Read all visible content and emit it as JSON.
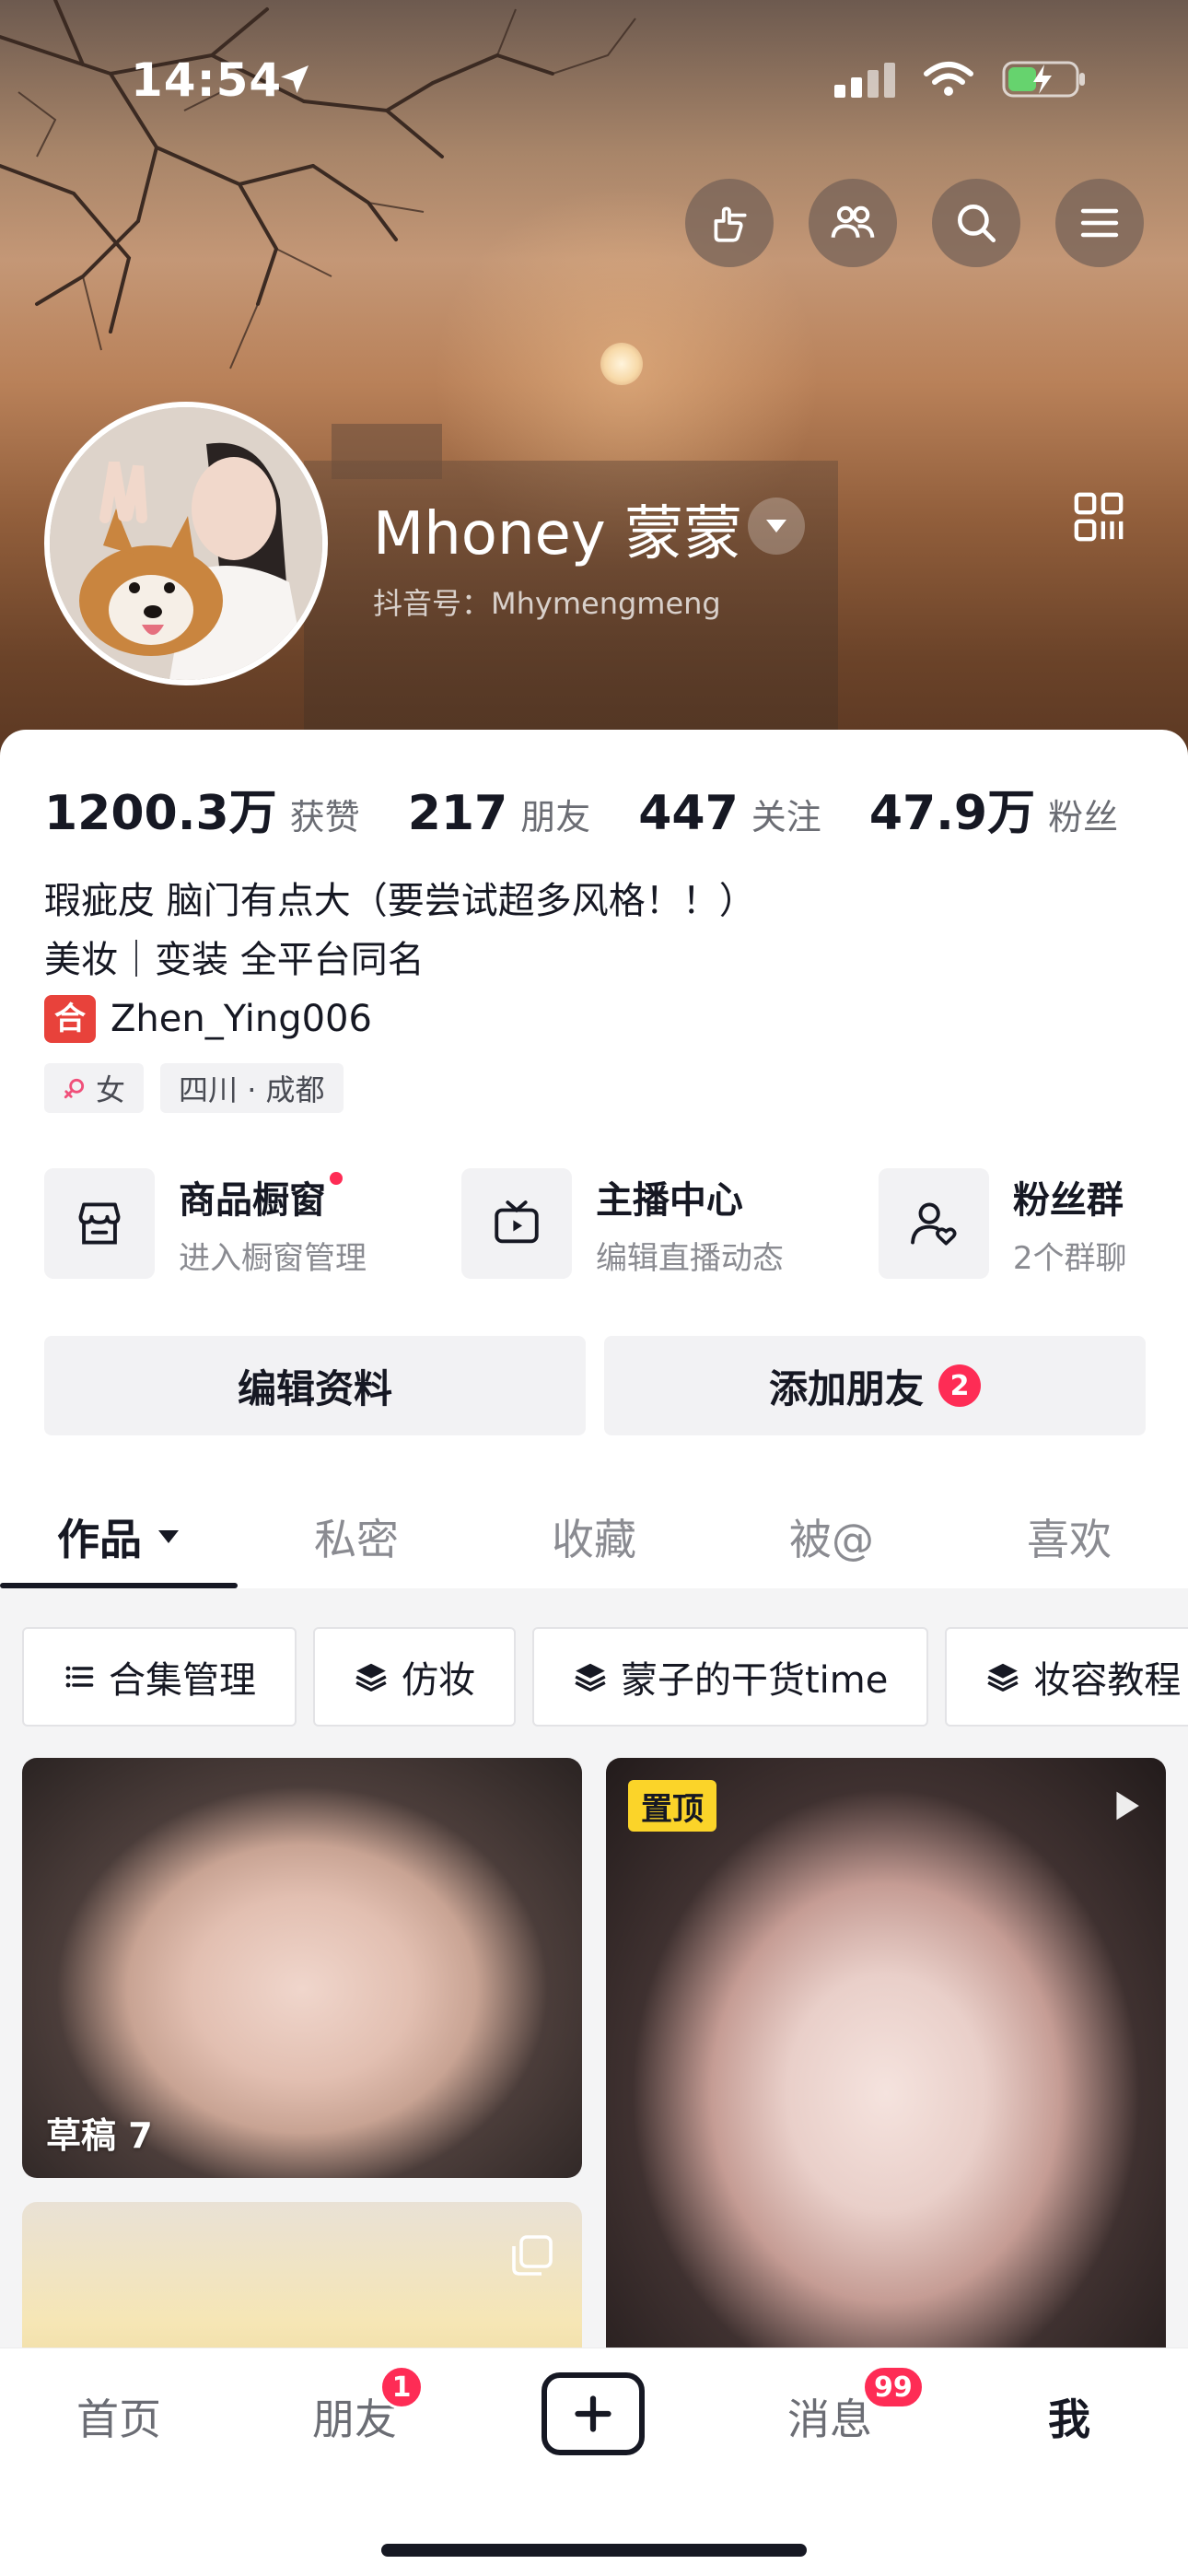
{
  "status_bar": {
    "time": "14:54"
  },
  "header": {
    "display_name": "Mhoney 蒙蒙",
    "douyin_id": "抖音号：Mhymengmeng",
    "top_buttons": [
      "hand-point-icon",
      "friends-icon",
      "search-icon",
      "menu-icon"
    ]
  },
  "stats": [
    {
      "num": "1200.3万",
      "label": "获赞"
    },
    {
      "num": "217",
      "label": "朋友"
    },
    {
      "num": "447",
      "label": "关注"
    },
    {
      "num": "47.9万",
      "label": "粉丝"
    }
  ],
  "bio": {
    "line1": "瑕疵皮 脑门有点大（要尝试超多风格！！）",
    "line2": "美妆｜变装 全平台同名",
    "line3_badge": "合",
    "line3_text": "Zhen_Ying006"
  },
  "tags": {
    "gender": "女",
    "location": "四川 · 成都"
  },
  "shortcuts": [
    {
      "title": "商品橱窗",
      "sub": "进入橱窗管理"
    },
    {
      "title": "主播中心",
      "sub": "编辑直播动态"
    },
    {
      "title": "粉丝群",
      "sub": "2个群聊"
    }
  ],
  "actions": {
    "edit_profile": "编辑资料",
    "add_friend": "添加朋友",
    "add_friend_badge": "2"
  },
  "tabs": [
    "作品",
    "私密",
    "收藏",
    "被@",
    "喜欢"
  ],
  "chips": [
    "合集管理",
    "仿妆",
    "蒙子的干货time",
    "妆容教程"
  ],
  "thumbs": {
    "draft_label": "草稿 7",
    "pinned_label": "置顶"
  },
  "bottom_nav": {
    "home": "首页",
    "friends": "朋友",
    "friends_badge": "1",
    "messages": "消息",
    "messages_badge": "99",
    "me": "我"
  },
  "colors": {
    "accent_red": "#fe2c55",
    "pin_yellow": "#fbd429",
    "text_primary": "#161823"
  }
}
